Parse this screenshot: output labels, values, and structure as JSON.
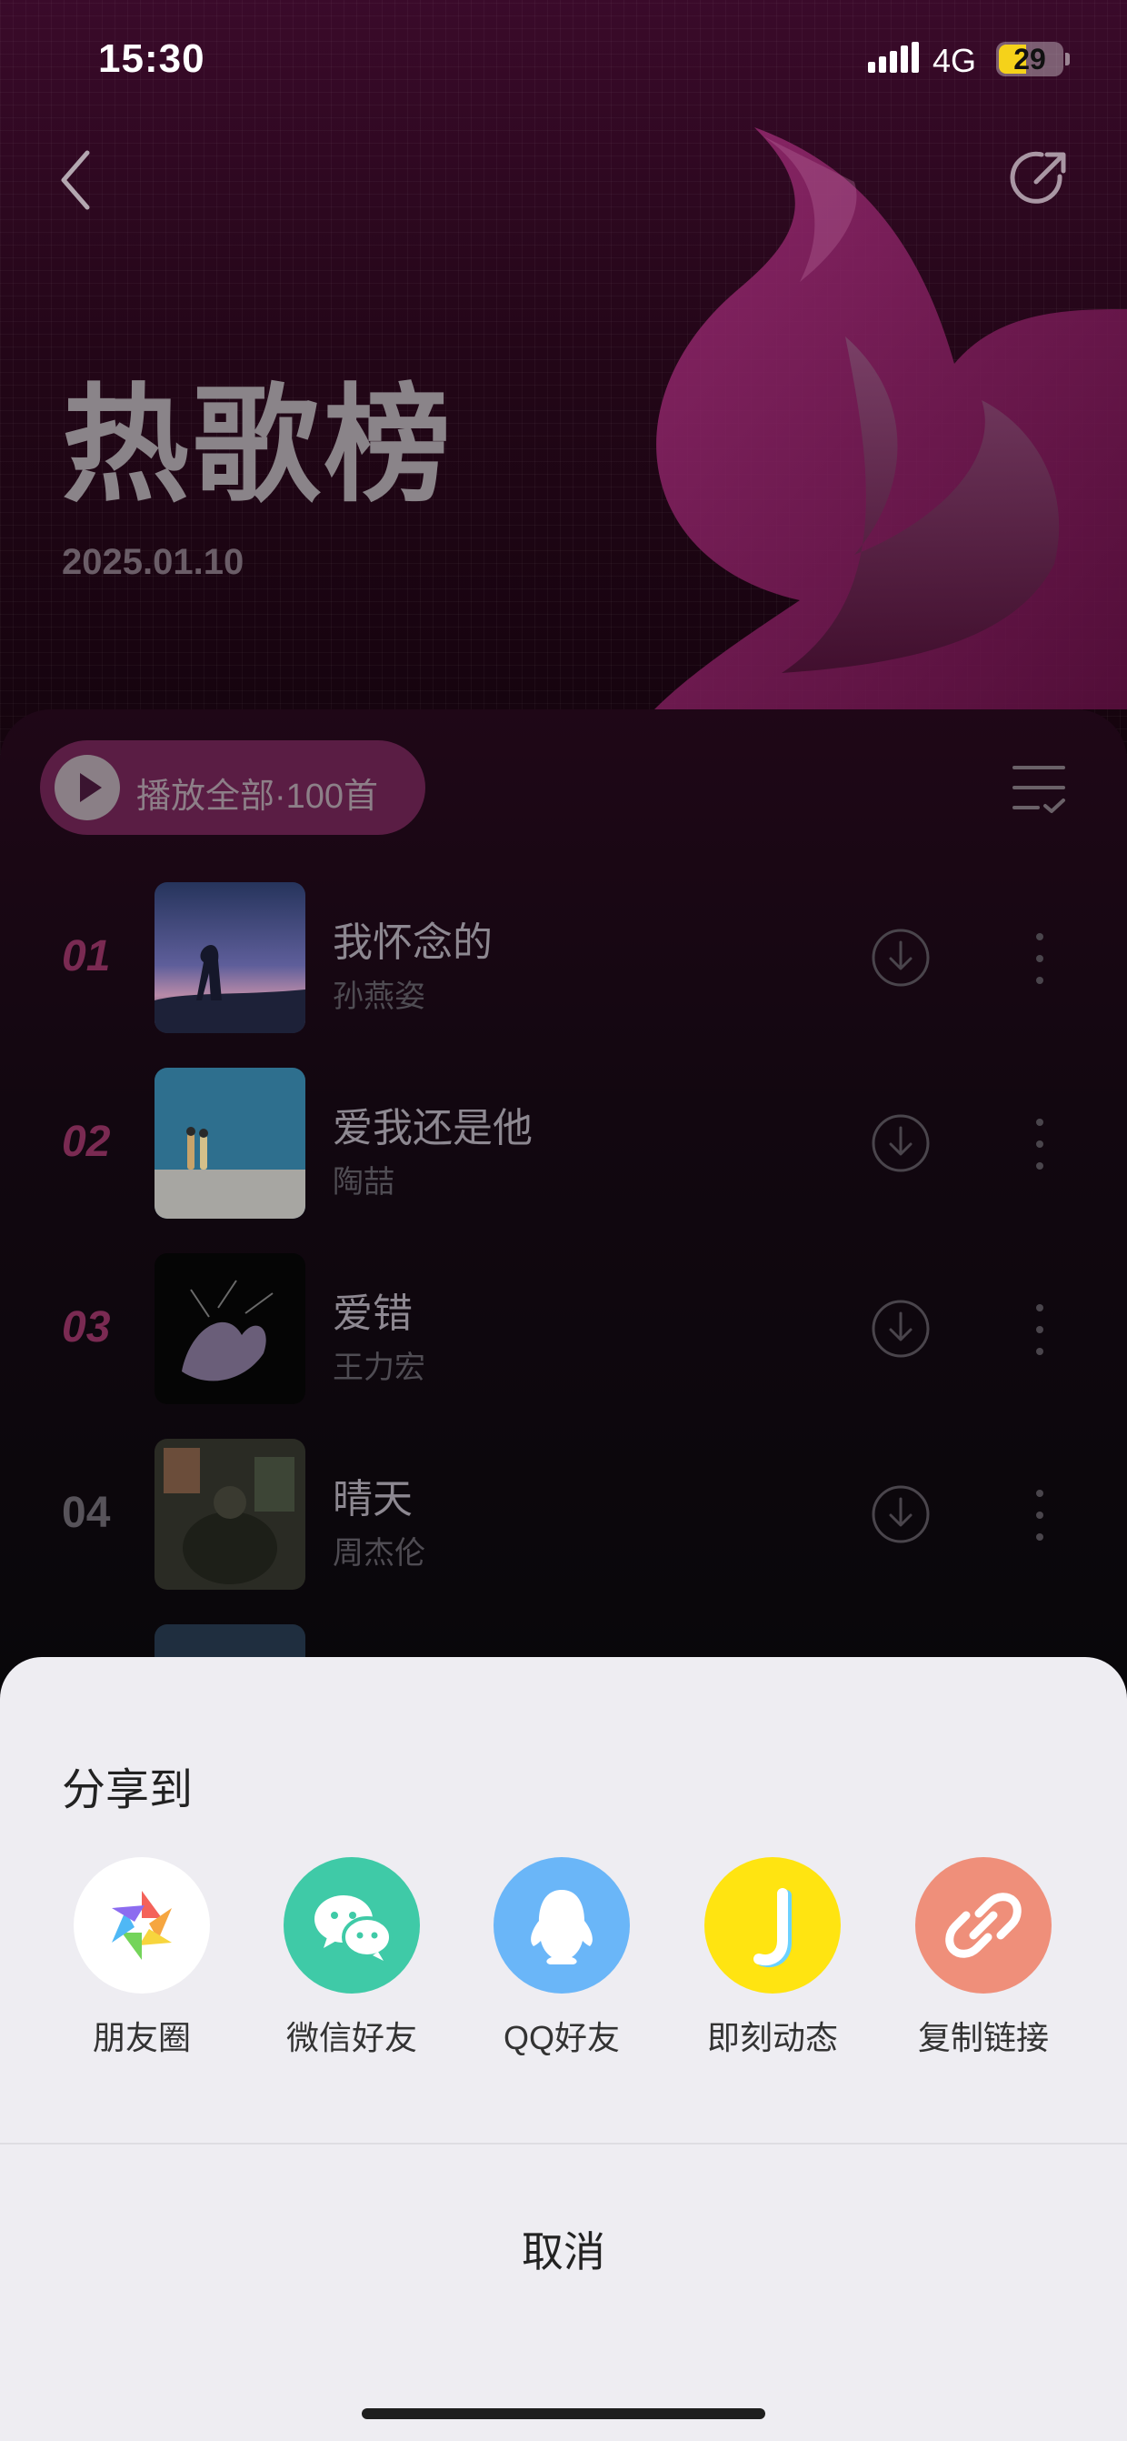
{
  "status": {
    "time": "15:30",
    "network": "4G",
    "battery": "29"
  },
  "header": {
    "title": "热歌榜",
    "date": "2025.01.10"
  },
  "list": {
    "play_all_label": "播放全部·100首",
    "songs": [
      {
        "rank": "01",
        "title": "我怀念的",
        "artist": "孙燕姿"
      },
      {
        "rank": "02",
        "title": "爱我还是他",
        "artist": "陶喆"
      },
      {
        "rank": "03",
        "title": "爱错",
        "artist": "王力宏"
      },
      {
        "rank": "04",
        "title": "晴天",
        "artist": "周杰伦"
      }
    ]
  },
  "share": {
    "title": "分享到",
    "options": [
      {
        "label": "朋友圈",
        "icon": "moments-icon",
        "color": "#ffffff"
      },
      {
        "label": "微信好友",
        "icon": "wechat-icon",
        "color": "#3fcaa7"
      },
      {
        "label": "QQ好友",
        "icon": "qq-icon",
        "color": "#6ab6f8"
      },
      {
        "label": "即刻动态",
        "icon": "jike-icon",
        "color": "#ffe411"
      },
      {
        "label": "复制链接",
        "icon": "link-icon",
        "color": "#ef8f7a"
      }
    ],
    "cancel_label": "取消"
  },
  "colors": {
    "accent_rank": "#7a2a52",
    "sheet_bg": "#eeedf2",
    "hero_bg": "#220617"
  }
}
